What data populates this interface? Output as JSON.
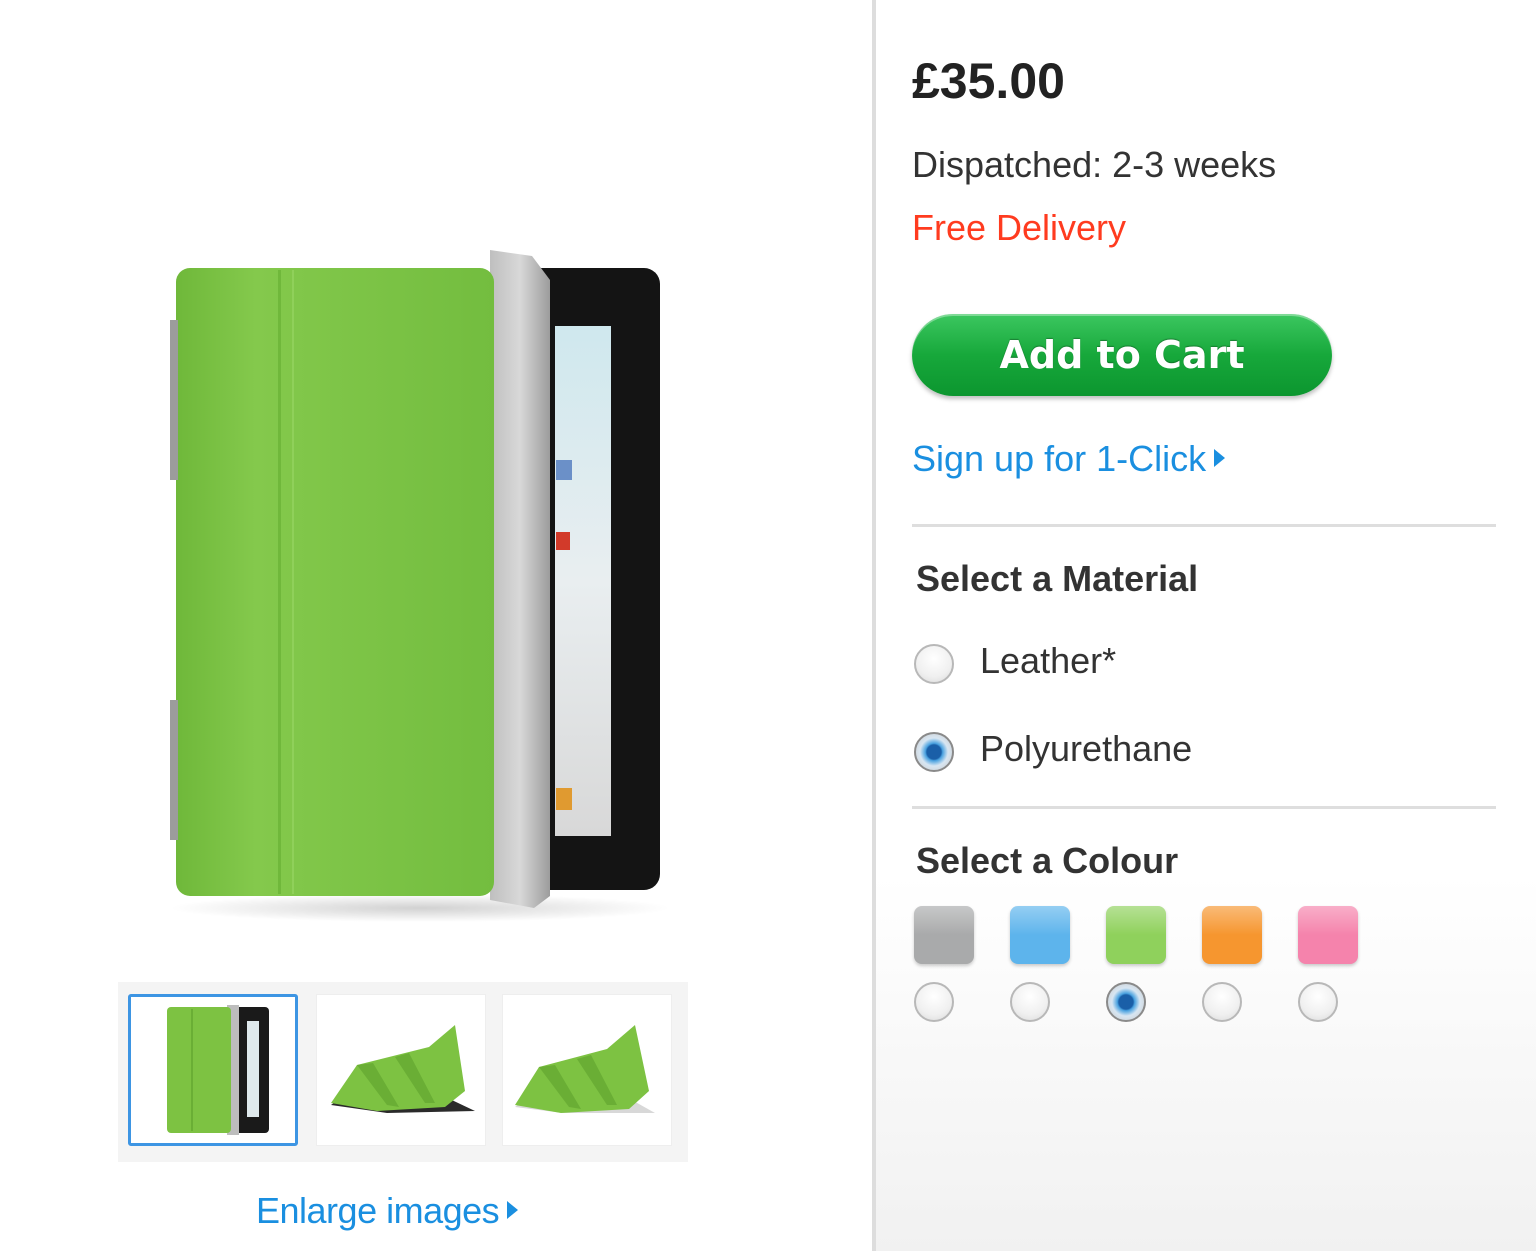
{
  "product": {
    "image_alt": "Green Smart Cover on black iPad"
  },
  "gallery": {
    "thumbnails": [
      {
        "name": "front-view",
        "selected": true
      },
      {
        "name": "stand-view",
        "selected": false
      },
      {
        "name": "stand-view-alt",
        "selected": false
      }
    ],
    "enlarge_label": "Enlarge images"
  },
  "purchase": {
    "price": "£35.00",
    "dispatch": "Dispatched: 2-3 weeks",
    "delivery": "Free Delivery",
    "add_to_cart": "Add to Cart",
    "one_click": "Sign up for 1-Click"
  },
  "material": {
    "heading": "Select a Material",
    "options": [
      {
        "label": "Leather*",
        "selected": false
      },
      {
        "label": "Polyurethane",
        "selected": true
      }
    ]
  },
  "colour": {
    "heading": "Select a Colour",
    "options": [
      {
        "name": "grey",
        "color": "#a9aaab",
        "selected": false
      },
      {
        "name": "blue",
        "color": "#5db4ec",
        "selected": false
      },
      {
        "name": "green",
        "color": "#8fd15c",
        "selected": true
      },
      {
        "name": "orange",
        "color": "#f6962f",
        "selected": false
      },
      {
        "name": "pink",
        "color": "#f583ac",
        "selected": false
      }
    ]
  },
  "colors": {
    "link": "#1a8fe0",
    "delivery": "#ff3b1f",
    "button": "#17a83b",
    "cover_green": "#7dc242"
  }
}
